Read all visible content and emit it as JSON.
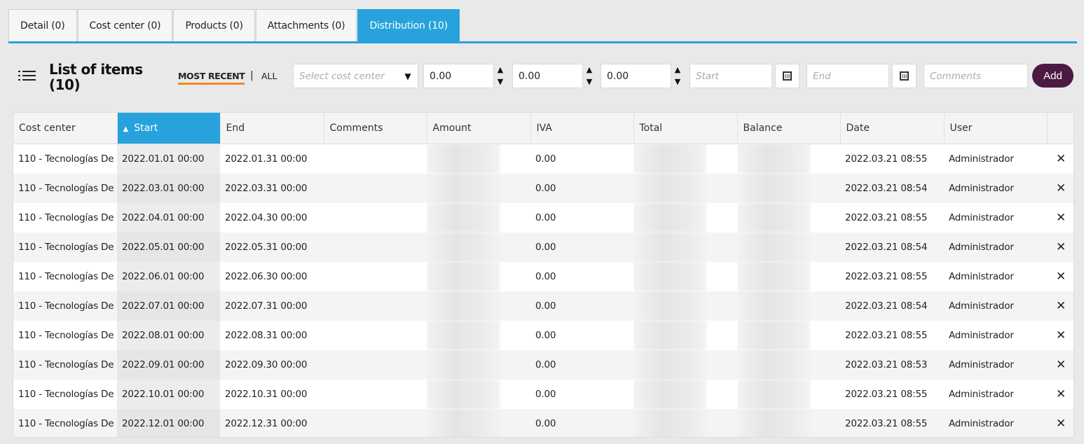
{
  "tabs": [
    {
      "label": "Detail (0)"
    },
    {
      "label": "Cost center (0)"
    },
    {
      "label": "Products (0)"
    },
    {
      "label": "Attachments (0)"
    },
    {
      "label": "Distribution (10)",
      "active": true
    }
  ],
  "toolbar": {
    "title": "List of items (10)",
    "filter_recent": "MOST RECENT",
    "filter_sep": "|",
    "filter_all": "ALL",
    "cost_center_placeholder": "Select cost center",
    "amount_value": "0.00",
    "iva_value": "0.00",
    "total_value": "0.00",
    "start_placeholder": "Start",
    "end_placeholder": "End",
    "comments_placeholder": "Comments",
    "add_label": "Add"
  },
  "icons": {
    "menu": "list-icon",
    "calendar": "calendar-icon",
    "delete": "close-icon",
    "spin_up": "▲",
    "spin_down": "▼",
    "sort": "▲",
    "delete_glyph": "✕"
  },
  "colors": {
    "accent": "#27a2dc",
    "add_button": "#4a1a43",
    "filter_underline": "#f28a1e"
  },
  "table": {
    "columns": [
      "Cost center",
      "Start",
      "End",
      "Comments",
      "Amount",
      "IVA",
      "Total",
      "Balance",
      "Date",
      "User",
      ""
    ],
    "sorted_column": "Start",
    "rows": [
      {
        "cost_center": "110 - Tecnologías De",
        "start": "2022.01.01 00:00",
        "end": "2022.01.31 00:00",
        "comments": "",
        "iva": "0.00",
        "date": "2022.03.21 08:55",
        "user": "Administrador"
      },
      {
        "cost_center": "110 - Tecnologías De",
        "start": "2022.03.01 00:00",
        "end": "2022.03.31 00:00",
        "comments": "",
        "iva": "0.00",
        "date": "2022.03.21 08:54",
        "user": "Administrador"
      },
      {
        "cost_center": "110 - Tecnologías De",
        "start": "2022.04.01 00:00",
        "end": "2022.04.30 00:00",
        "comments": "",
        "iva": "0.00",
        "date": "2022.03.21 08:55",
        "user": "Administrador"
      },
      {
        "cost_center": "110 - Tecnologías De",
        "start": "2022.05.01 00:00",
        "end": "2022.05.31 00:00",
        "comments": "",
        "iva": "0.00",
        "date": "2022.03.21 08:54",
        "user": "Administrador"
      },
      {
        "cost_center": "110 - Tecnologías De",
        "start": "2022.06.01 00:00",
        "end": "2022.06.30 00:00",
        "comments": "",
        "iva": "0.00",
        "date": "2022.03.21 08:55",
        "user": "Administrador"
      },
      {
        "cost_center": "110 - Tecnologías De",
        "start": "2022.07.01 00:00",
        "end": "2022.07.31 00:00",
        "comments": "",
        "iva": "0.00",
        "date": "2022.03.21 08:54",
        "user": "Administrador"
      },
      {
        "cost_center": "110 - Tecnologías De",
        "start": "2022.08.01 00:00",
        "end": "2022.08.31 00:00",
        "comments": "",
        "iva": "0.00",
        "date": "2022.03.21 08:55",
        "user": "Administrador"
      },
      {
        "cost_center": "110 - Tecnologías De",
        "start": "2022.09.01 00:00",
        "end": "2022.09.30 00:00",
        "comments": "",
        "iva": "0.00",
        "date": "2022.03.21 08:53",
        "user": "Administrador"
      },
      {
        "cost_center": "110 - Tecnologías De",
        "start": "2022.10.01 00:00",
        "end": "2022.10.31 00:00",
        "comments": "",
        "iva": "0.00",
        "date": "2022.03.21 08:55",
        "user": "Administrador"
      },
      {
        "cost_center": "110 - Tecnologías De",
        "start": "2022.12.01 00:00",
        "end": "2022.12.31 00:00",
        "comments": "",
        "iva": "0.00",
        "date": "2022.03.21 08:55",
        "user": "Administrador"
      }
    ]
  }
}
